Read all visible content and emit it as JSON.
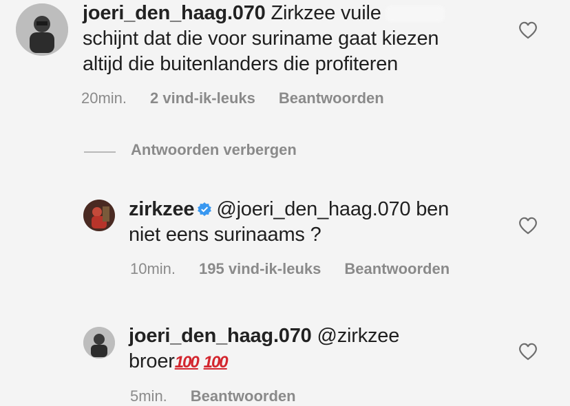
{
  "comments": [
    {
      "username": "joeri_den_haag.070",
      "line1": "Zirkzee vuile",
      "line2": "schijnt dat die voor suriname gaat kiezen",
      "line3": "altijd die buitenlanders die profiteren",
      "time": "20min.",
      "likes": "2 vind-ik-leuks",
      "reply": "Beantwoorden"
    },
    {
      "username": "zirkzee",
      "line1": "@joeri_den_haag.070 ben",
      "line2": "niet eens surinaams ?",
      "time": "10min.",
      "likes": "195 vind-ik-leuks",
      "reply": "Beantwoorden"
    },
    {
      "username": "joeri_den_haag.070",
      "line1": "@zirkzee",
      "line2": "broer",
      "emoji": "100",
      "time": "5min.",
      "reply": "Beantwoorden"
    }
  ],
  "toggle_replies": "Antwoorden verbergen",
  "icons": [
    "heart-icon",
    "verified-badge-icon",
    "hundred-points-emoji"
  ],
  "colors": {
    "background": "#f4f4f4",
    "meta_text": "#8a8a8a",
    "verified": "#3897f0",
    "emoji": "#d3262e"
  }
}
